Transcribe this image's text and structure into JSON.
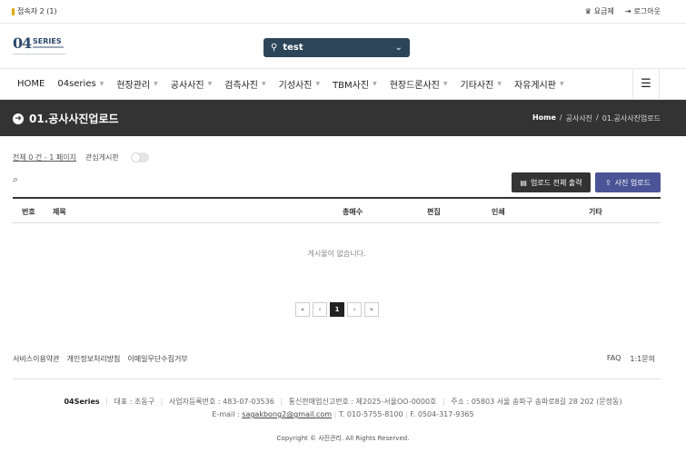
{
  "topbar": {
    "visitors": "접속자 2 (1)",
    "pricing": "요금제",
    "logout": "로그아웃"
  },
  "header": {
    "logo_mark": "04",
    "logo_word": "SERIES",
    "project": "test"
  },
  "nav": {
    "items": [
      {
        "label": "HOME",
        "dropdown": false
      },
      {
        "label": "04series",
        "dropdown": true
      },
      {
        "label": "현장관리",
        "dropdown": true
      },
      {
        "label": "공사사진",
        "dropdown": true
      },
      {
        "label": "검측사진",
        "dropdown": true
      },
      {
        "label": "기성사진",
        "dropdown": true
      },
      {
        "label": "TBM사진",
        "dropdown": true
      },
      {
        "label": "현장드론사진",
        "dropdown": true
      },
      {
        "label": "기타사진",
        "dropdown": true
      },
      {
        "label": "자유게시판",
        "dropdown": true
      }
    ]
  },
  "page": {
    "title": "01.공사사진업로드",
    "breadcrumb": {
      "home": "Home",
      "parent": "공사사진",
      "current": "01.공사사진업로드"
    }
  },
  "list": {
    "count_text": "전체 0 건 - 1 페이지",
    "favorite_label": "관심게시판",
    "print_button": "업로드 전체 출력",
    "upload_button": "사진 업로드",
    "columns": {
      "num": "번호",
      "subject": "제목",
      "photos": "총매수",
      "edit": "편집",
      "print": "인쇄",
      "etc": "기타"
    },
    "empty_message": "게시물이 없습니다."
  },
  "pager": {
    "first": "«",
    "prev": "‹",
    "current": "1",
    "next": "›",
    "last": "»"
  },
  "footer": {
    "links_left": [
      "서비스이용약관",
      "개인정보처리방침",
      "이메일무단수집거부"
    ],
    "links_right": [
      "FAQ",
      "1:1문의"
    ],
    "company": "04Series",
    "ceo": "대표 : 조동구",
    "biz_no": "사업자등록번호 : 483-07-03536",
    "mail_order_no": "통신판매업신고번호 : 제2025-서울OO-0000호",
    "address": "주소 : 05803 서울 송파구 송파로8길 28 202 (문정동)",
    "email_label": "E-mail :",
    "email": "sagakbong2@gmail.com",
    "tel": "T. 010-5755-8100",
    "fax": "F. 0504-317-9365",
    "copyright": "Copyright © 사진관리. All Rights Reserved."
  },
  "colors": {
    "title_band": "#333333",
    "project_select": "#2c4559",
    "upload_button": "#4a5496"
  }
}
